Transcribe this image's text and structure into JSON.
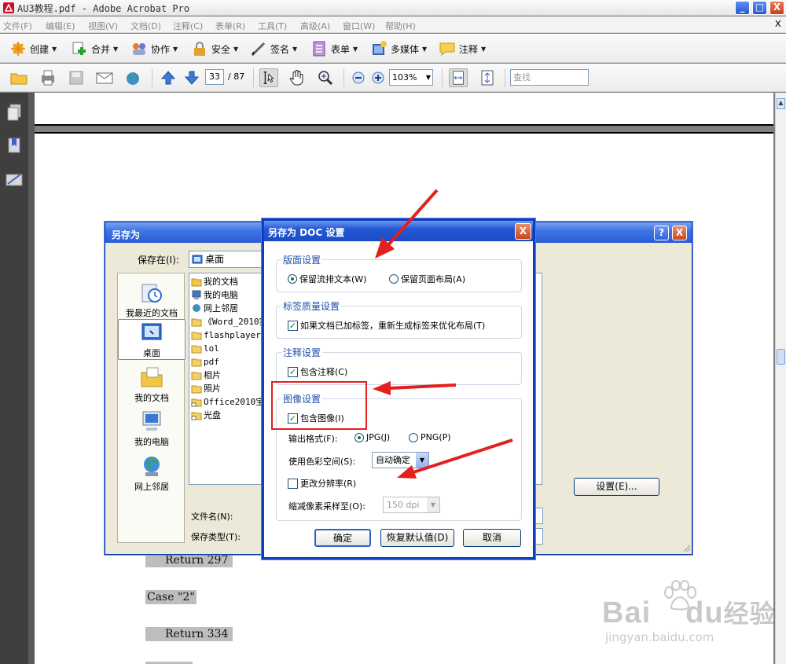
{
  "window": {
    "title": "AU3教程.pdf - Adobe Acrobat Pro",
    "minimize": "_",
    "maximize": "□",
    "close": "X"
  },
  "menu": {
    "items": [
      "文件(F)",
      "编辑(E)",
      "视图(V)",
      "文档(D)",
      "注释(C)",
      "表单(R)",
      "工具(T)",
      "高级(A)",
      "窗口(W)",
      "帮助(H)"
    ],
    "close": "x"
  },
  "toolbar1": {
    "items": [
      {
        "label": "创建",
        "icon": "create-icon"
      },
      {
        "label": "合并",
        "icon": "combine-icon"
      },
      {
        "label": "协作",
        "icon": "collaborate-icon"
      },
      {
        "label": "安全",
        "icon": "lock-icon"
      },
      {
        "label": "签名",
        "icon": "pen-icon"
      },
      {
        "label": "表单",
        "icon": "form-icon"
      },
      {
        "label": "多媒体",
        "icon": "multimedia-icon"
      },
      {
        "label": "注释",
        "icon": "comment-icon"
      }
    ]
  },
  "toolbar2": {
    "page_current": "33",
    "page_total": "/ 87",
    "zoom": "103%",
    "find_placeholder": "查找"
  },
  "document": {
    "lines": [
      "Return 297",
      "Case \"2\"",
      "Return 334"
    ]
  },
  "save_dialog": {
    "title": "另存为",
    "help": "?",
    "close": "X",
    "save_in_label": "保存在(I):",
    "save_in_value": "桌面",
    "places": [
      "我最近的文档",
      "桌面",
      "我的文档",
      "我的电脑",
      "网上邻居"
    ],
    "files": [
      "我的文档",
      "我的电脑",
      "网上邻居",
      "《Word_2010实",
      "flashplayer3",
      "lol",
      "pdf",
      "相片",
      "照片",
      "Office2010宝",
      "光盘"
    ],
    "filename_label": "文件名(N):",
    "filetype_label": "保存类型(T):",
    "settings_button": "设置(E)..."
  },
  "doc_dialog": {
    "title": "另存为 DOC 设置",
    "close": "X",
    "layout_group": "版面设置",
    "layout_opt1": "保留流排文本(W)",
    "layout_opt2": "保留页面布局(A)",
    "tag_group": "标签质量设置",
    "tag_opt": "如果文档已加标签，重新生成标签来优化布局(T)",
    "comment_group": "注释设置",
    "comment_opt": "包含注释(C)",
    "image_group": "图像设置",
    "image_opt": "包含图像(I)",
    "format_label": "输出格式(F):",
    "format_jpg": "JPG(J)",
    "format_png": "PNG(P)",
    "color_label": "使用色彩空间(S):",
    "color_value": "自动确定",
    "res_opt": "更改分辨率(R)",
    "sample_label": "缩减像素采样至(O):",
    "sample_value": "150 dpi",
    "ok": "确定",
    "restore": "恢复默认值(D)",
    "cancel": "取消"
  },
  "watermark": {
    "brand": "Bai",
    "brand2": "du",
    "cn": "经验",
    "url": "jingyan.baidu.com"
  },
  "colors": {
    "highlight": "#e3201b",
    "xp_blue": "#0b3fbf",
    "doc_bg": "#ffffff"
  }
}
